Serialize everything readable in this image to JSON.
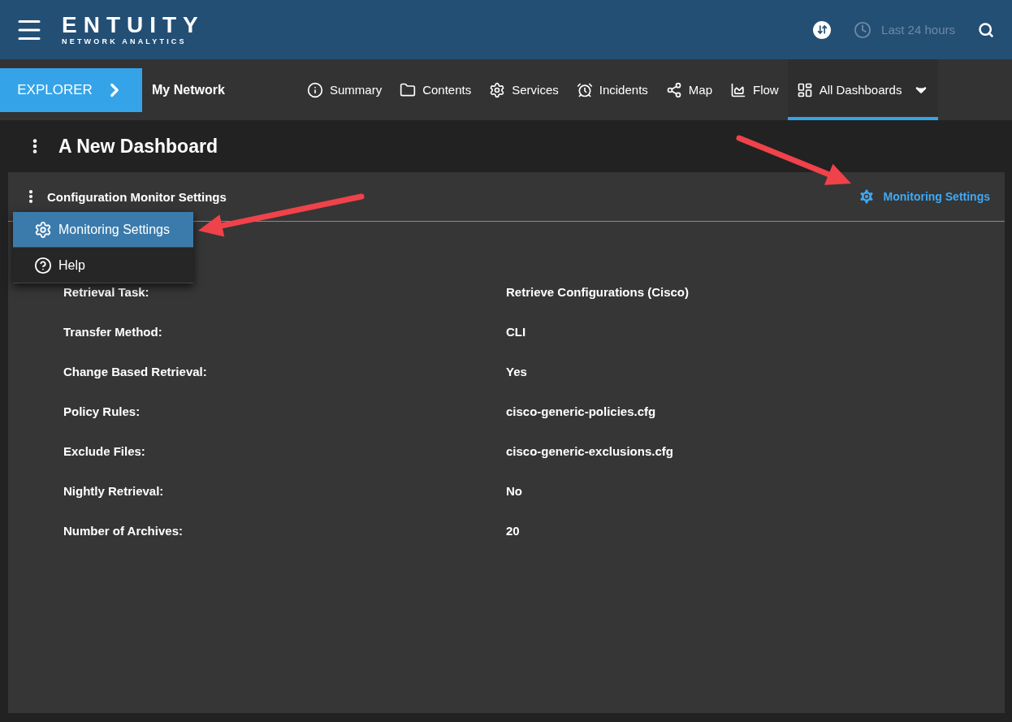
{
  "header": {
    "logo": "ENTUITY",
    "tagline": "NETWORK ANALYTICS",
    "time_range": "Last 24 hours"
  },
  "nav": {
    "explorer": "EXPLORER",
    "context": "My Network",
    "tabs": [
      {
        "label": "Summary",
        "selected": false
      },
      {
        "label": "Contents",
        "selected": false
      },
      {
        "label": "Services",
        "selected": false
      },
      {
        "label": "Incidents",
        "selected": false
      },
      {
        "label": "Map",
        "selected": false
      },
      {
        "label": "Flow",
        "selected": false
      },
      {
        "label": "All Dashboards",
        "selected": true
      }
    ]
  },
  "dashboard": {
    "title": "A New Dashboard"
  },
  "panel": {
    "title": "Configuration Monitor Settings",
    "action": "Monitoring Settings",
    "menu": [
      {
        "label": "Monitoring Settings",
        "selected": true
      },
      {
        "label": "Help",
        "selected": false
      }
    ],
    "rows": [
      {
        "label": "Retrieval Task:",
        "value": "Retrieve Configurations (Cisco)"
      },
      {
        "label": "Transfer Method:",
        "value": "CLI"
      },
      {
        "label": "Change Based Retrieval:",
        "value": "Yes"
      },
      {
        "label": "Policy Rules:",
        "value": "cisco-generic-policies.cfg"
      },
      {
        "label": "Exclude Files:",
        "value": "cisco-generic-exclusions.cfg"
      },
      {
        "label": "Nightly Retrieval:",
        "value": "No"
      },
      {
        "label": "Number of Archives:",
        "value": "20"
      }
    ]
  }
}
